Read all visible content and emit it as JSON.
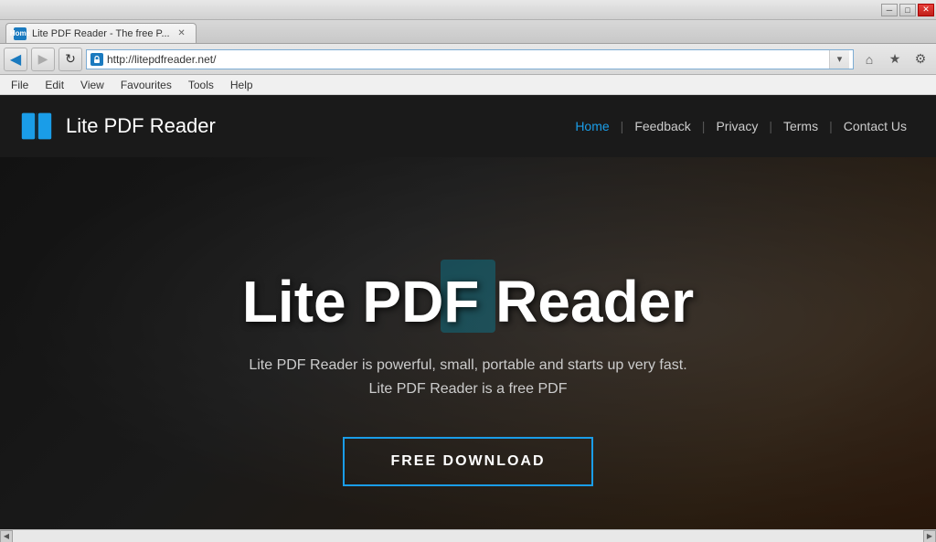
{
  "browser": {
    "title_bar": {
      "minimize_label": "─",
      "restore_label": "□",
      "close_label": "✕"
    },
    "tab": {
      "favicon_text": "P",
      "title": "Lite PDF Reader - The free P...",
      "close_label": "✕"
    },
    "address_bar": {
      "lock_icon": "🔒",
      "url": "http://litepdfreader.net/",
      "search_icon": "▾",
      "back_icon": "◀",
      "forward_icon": "▶",
      "refresh_icon": "↻",
      "home_icon": "⌂",
      "favorites_icon": "★",
      "settings_icon": "⚙"
    },
    "menu": {
      "items": [
        "File",
        "Edit",
        "View",
        "Favourites",
        "Tools",
        "Help"
      ]
    }
  },
  "website": {
    "header": {
      "logo_text": "Lite PDF Reader",
      "nav": [
        {
          "label": "Home",
          "active": true
        },
        {
          "label": "Feedback",
          "active": false
        },
        {
          "label": "Privacy",
          "active": false
        },
        {
          "label": "Terms",
          "active": false
        },
        {
          "label": "Contact Us",
          "active": false
        }
      ]
    },
    "hero": {
      "title": "Lite PDF Reader",
      "subtitle_line1": "Lite PDF Reader is powerful, small, portable and starts up very fast.",
      "subtitle_line2": "Lite PDF Reader is a free PDF",
      "download_button": "FREE DOWNLOAD"
    }
  },
  "scrollbar": {
    "left_arrow": "◀",
    "right_arrow": "▶"
  }
}
